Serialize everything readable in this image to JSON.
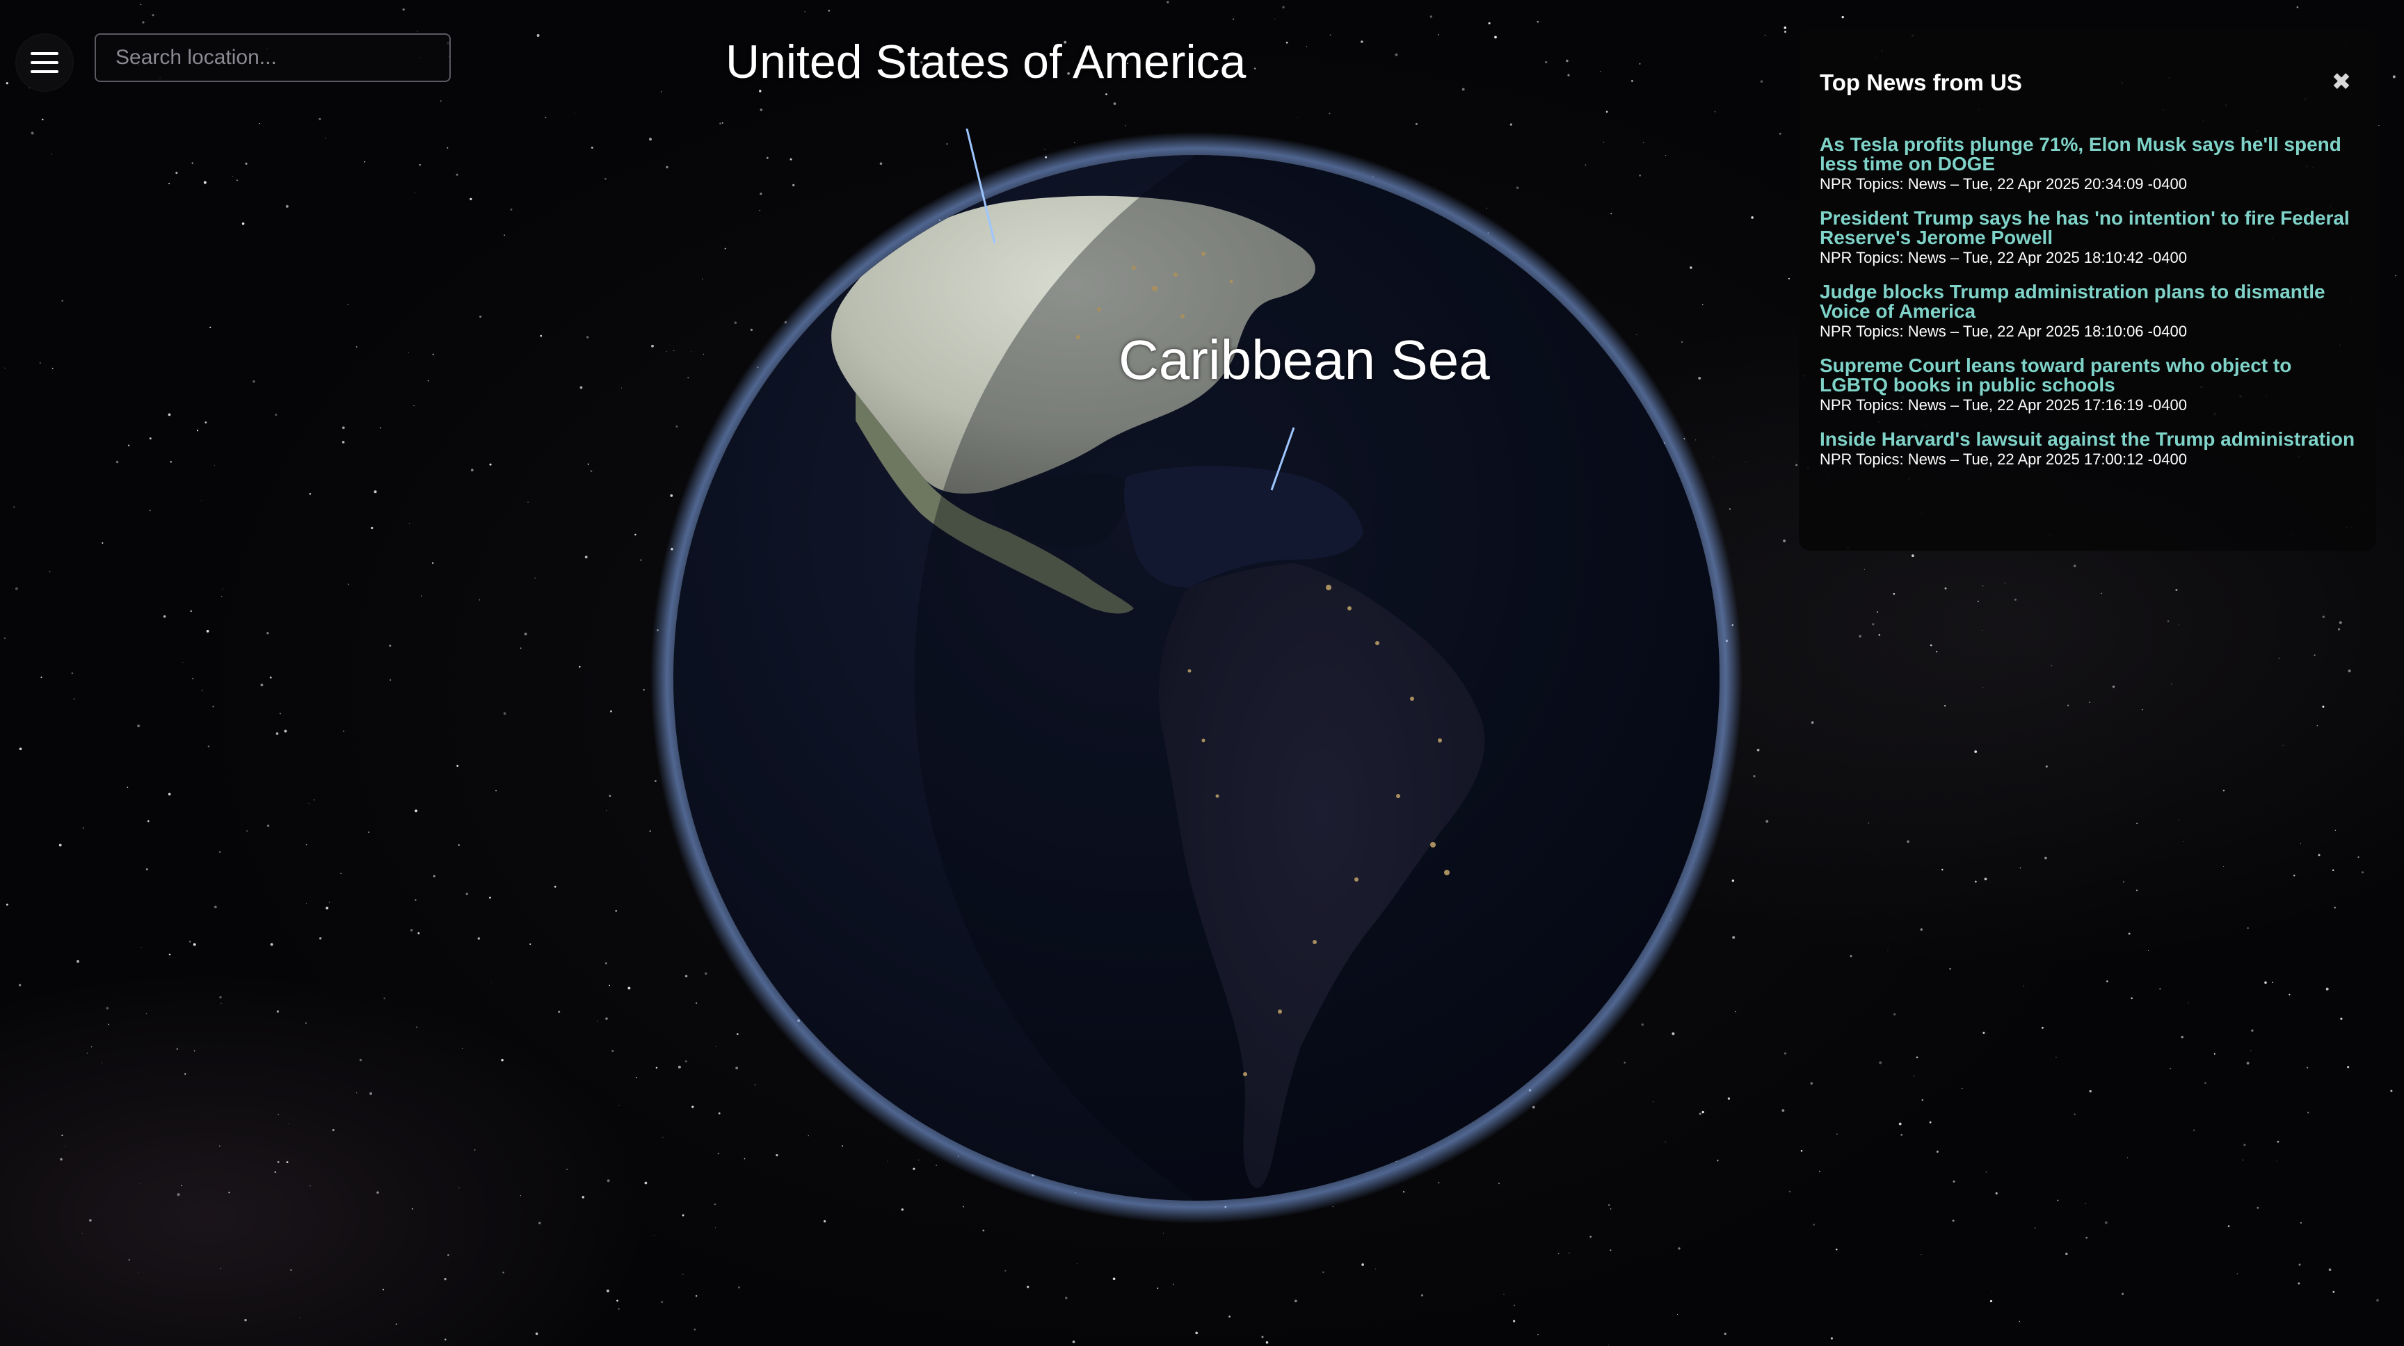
{
  "search": {
    "placeholder": "Search location..."
  },
  "globe": {
    "labels": [
      "United States of America",
      "Caribbean Sea"
    ]
  },
  "news_panel": {
    "title": "Top News from US",
    "close_icon": "close-icon",
    "items": [
      {
        "headline": "As Tesla profits plunge 71%, Elon Musk says he'll spend less time on DOGE",
        "meta": "NPR Topics: News – Tue, 22 Apr 2025 20:34:09 -0400"
      },
      {
        "headline": "President Trump says he has 'no intention' to fire Federal Reserve's Jerome Powell",
        "meta": "NPR Topics: News – Tue, 22 Apr 2025 18:10:42 -0400"
      },
      {
        "headline": "Judge blocks Trump administration plans to dismantle Voice of America",
        "meta": "NPR Topics: News – Tue, 22 Apr 2025 18:10:06 -0400"
      },
      {
        "headline": "Supreme Court leans toward parents who object to LGBTQ books in public schools",
        "meta": "NPR Topics: News – Tue, 22 Apr 2025 17:16:19 -0400"
      },
      {
        "headline": "Inside Harvard's lawsuit against the Trump administration",
        "meta": "NPR Topics: News – Tue, 22 Apr 2025 17:00:12 -0400"
      }
    ]
  },
  "icons": {
    "menu": "hamburger-menu-icon",
    "close": "close-icon"
  },
  "colors": {
    "headline": "#7fd3c8",
    "panel_background": "#060608",
    "space": "#05060a",
    "ocean_night": "#0b1020",
    "atmosphere": "#8fb6ff"
  }
}
